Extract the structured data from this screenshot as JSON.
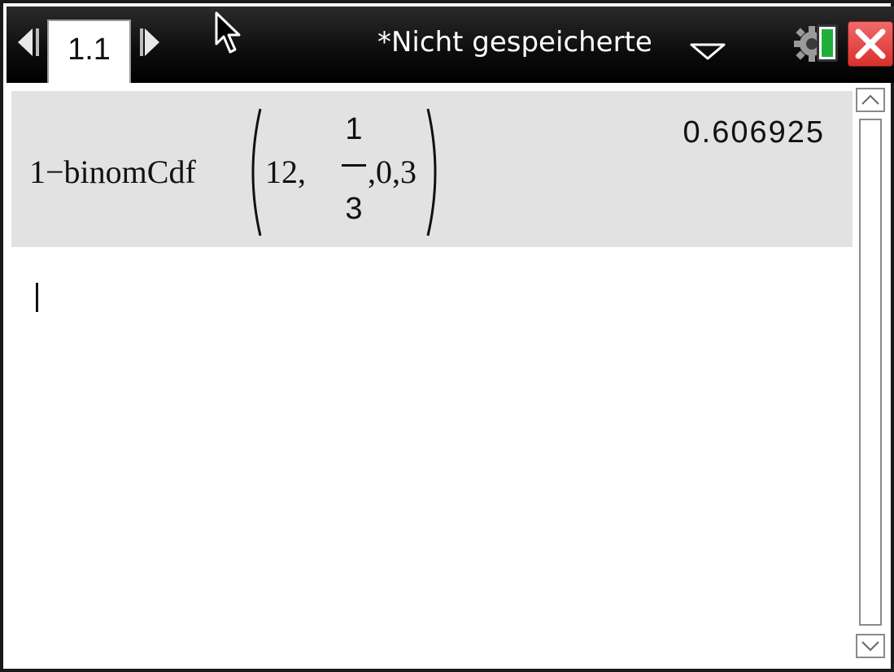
{
  "titlebar": {
    "tab_label": "1.1",
    "document_title": "*Nicht gespeicherte",
    "accent_colors": {
      "close_button": "#d9302c",
      "battery": "#1fb03a"
    },
    "icons": [
      "chevron-left-icon",
      "chevron-right-icon",
      "dropdown-triangle-icon",
      "gear-icon",
      "battery-icon",
      "close-icon",
      "mouse-pointer-icon"
    ]
  },
  "calculator": {
    "history": [
      {
        "expression_prefix": "1−binomCdf",
        "args_before_fraction": "12,",
        "fraction_numerator": "1",
        "fraction_denominator": "3",
        "args_after_fraction": ",0,3",
        "result": "0.606925"
      }
    ],
    "entry_value": ""
  }
}
